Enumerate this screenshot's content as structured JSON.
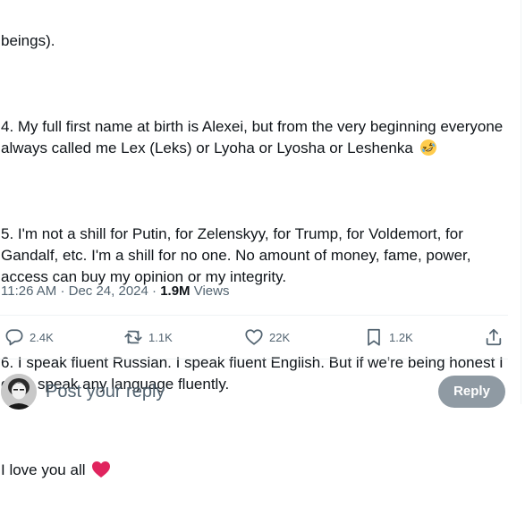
{
  "tweet": {
    "paragraphs": [
      "beings).",
      "4. My full first name at birth is Alexei, but from the very beginning everyone always called me Lex (Leks) or Lyoha or Lyosha or Leshenka",
      "5. I'm not a shill for Putin, for Zelenskyy, for Trump, for Voldemort, for Gandalf, etc. I'm a shill for no one. No amount of money, fame, power, access can buy my opinion or my integrity.",
      "6. I speak fluent Russian. I speak fluent English. But if we're being honest I don't speak any language fluently.",
      "I love you all"
    ],
    "emoji_after_p4": "rolling-on-floor-laughing-emoji",
    "emoji_after_closing": "red-heart-emoji"
  },
  "meta": {
    "time": "11:26 AM",
    "separator": "·",
    "date": "Dec 24, 2024",
    "views_count": "1.9M",
    "views_label": "Views"
  },
  "actions": {
    "replies": "2.4K",
    "reposts": "1.1K",
    "likes": "22K",
    "bookmarks": "1.2K"
  },
  "composer": {
    "placeholder": "Post your reply",
    "reply_button": "Reply"
  },
  "colors": {
    "text": "#0f1419",
    "secondary": "#536471",
    "divider": "#eff3f4",
    "heart": "#e0245e",
    "reply_button_bg": "#8f9aa3"
  }
}
